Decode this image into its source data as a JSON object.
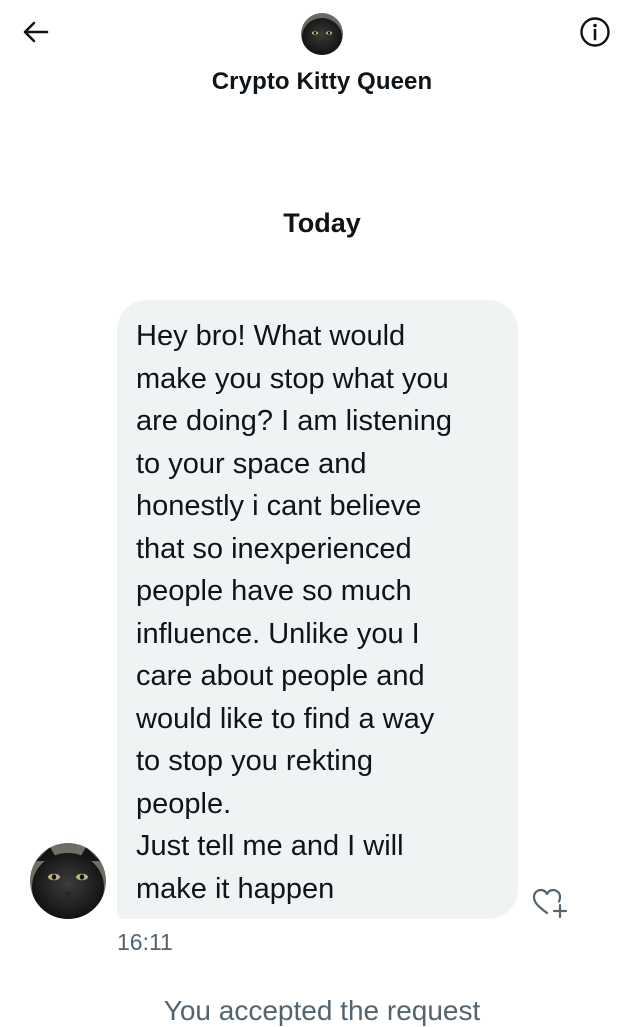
{
  "header": {
    "back_icon": "arrow-left-icon",
    "info_icon": "info-circle-icon",
    "contact_name": "Crypto Kitty Queen",
    "avatar": "black-cat-avatar"
  },
  "conversation": {
    "date_label": "Today",
    "messages": [
      {
        "direction": "incoming",
        "text": "Hey bro! What would\nmake you stop what you\nare doing? I am listening\nto your space and\nhonestly i cant believe\nthat so inexperienced\npeople have so much\ninfluence. Unlike you I\ncare about people and\nwould like to find a way\nto stop you rekting\npeople.\nJust tell me and I will\nmake it happen",
        "time": "16:11",
        "sender_avatar": "black-cat-avatar",
        "reaction_icon": "heart-plus-icon"
      }
    ],
    "system_message": "You accepted the request"
  },
  "colors": {
    "text_primary": "#0f1419",
    "text_secondary": "#536471",
    "bubble_background": "#eff3f4",
    "page_background": "#ffffff"
  }
}
